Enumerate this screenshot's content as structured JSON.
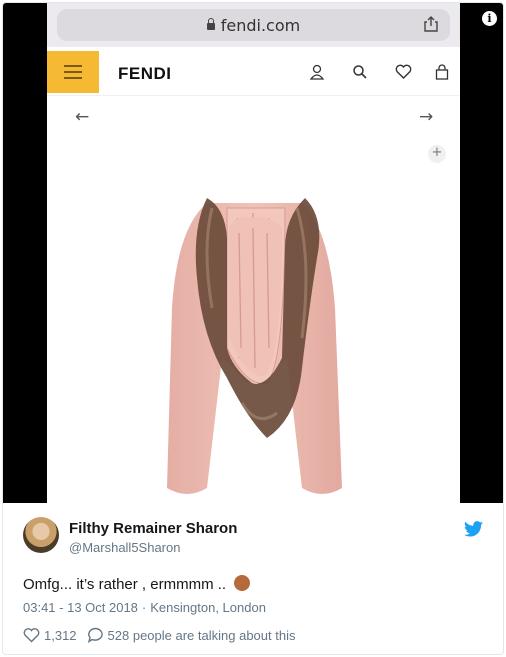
{
  "browser": {
    "url": "fendi.com"
  },
  "site": {
    "brand": "FENDI",
    "icons": [
      "menu-icon",
      "user-icon",
      "search-icon",
      "heart-icon",
      "bag-icon",
      "arrow-left-icon",
      "arrow-right-icon",
      "plus-icon"
    ]
  },
  "tweet": {
    "author_name": "Filthy Remainer Sharon",
    "author_handle": "@Marshall5Sharon",
    "text": "Omfg... it’s rather , ermmmm ..",
    "time": "03:41 - 13 Oct 2018",
    "separator": "·",
    "location": "Kensington, London",
    "likes": "1,312",
    "conversation": "528 people are talking about this"
  },
  "colors": {
    "twitter_blue": "#1da1f2",
    "menu_yellow": "#f6b934",
    "scarf_pink": "#e8b3a9",
    "fur_brown": "#6b4b3a"
  }
}
